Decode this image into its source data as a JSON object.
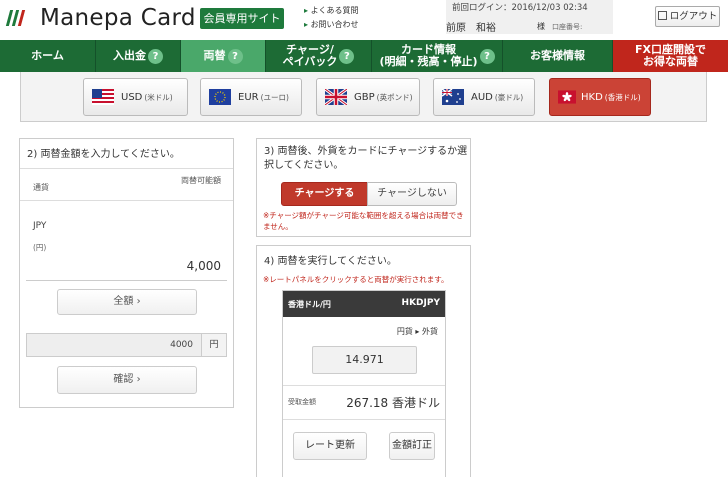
{
  "header": {
    "logo_text": "Manepa Card",
    "member_badge": "会員専用サイト",
    "help_links": [
      "よくある質問",
      "お問い合わせ"
    ],
    "last_login": "前回ログイン：2016/12/03 02:34",
    "user_name": "前原　和裕",
    "user_suffix": "様",
    "card_no_label": "口座番号:",
    "logout_label": "ログアウト"
  },
  "nav": {
    "items": [
      "ホーム",
      "入出金",
      "両替",
      "チャージ/\nペイバック",
      "カード情報\n(明細・残高・停止)",
      "お客様情報",
      "FX口座開設で\nお得な両替"
    ],
    "help_mark": "?"
  },
  "currencies": [
    {
      "code": "USD",
      "name": "(米ドル)"
    },
    {
      "code": "EUR",
      "name": "(ユーロ)"
    },
    {
      "code": "GBP",
      "name": "(英ポンド)"
    },
    {
      "code": "AUD",
      "name": "(豪ドル)"
    },
    {
      "code": "HKD",
      "name": "(香港ドル)"
    }
  ],
  "panel2": {
    "title": "2) 両替金額を入力してください。",
    "col_currency": "通貨",
    "col_available": "両替可能額",
    "currency_code": "JPY",
    "currency_unit": "(円)",
    "available_amount": "4,000",
    "all_amount_label": "全額 ›",
    "input_value": "4000",
    "input_unit": "円",
    "confirm_label": "確認 ›"
  },
  "panel3": {
    "title": "3) 両替後、外貨をカードにチャージするか選択してください。",
    "charge_yes": "チャージする",
    "charge_no": "チャージしない",
    "note": "※チャージ額がチャージ可能な範囲を超える場合は両替できません。"
  },
  "panel4": {
    "title": "4) 両替を実行してください。",
    "note": "※レートパネルをクリックすると両替が実行されます。",
    "rate_title": "香港ドル/円",
    "rate_code": "HKDJPY",
    "direction": "円貨 ▸ 外貨",
    "rate_value": "14.971",
    "receive_label": "受取金額",
    "receive_value": "267.18 香港ドル",
    "refresh_label": "レート更新",
    "correct_label": "金額訂正"
  }
}
